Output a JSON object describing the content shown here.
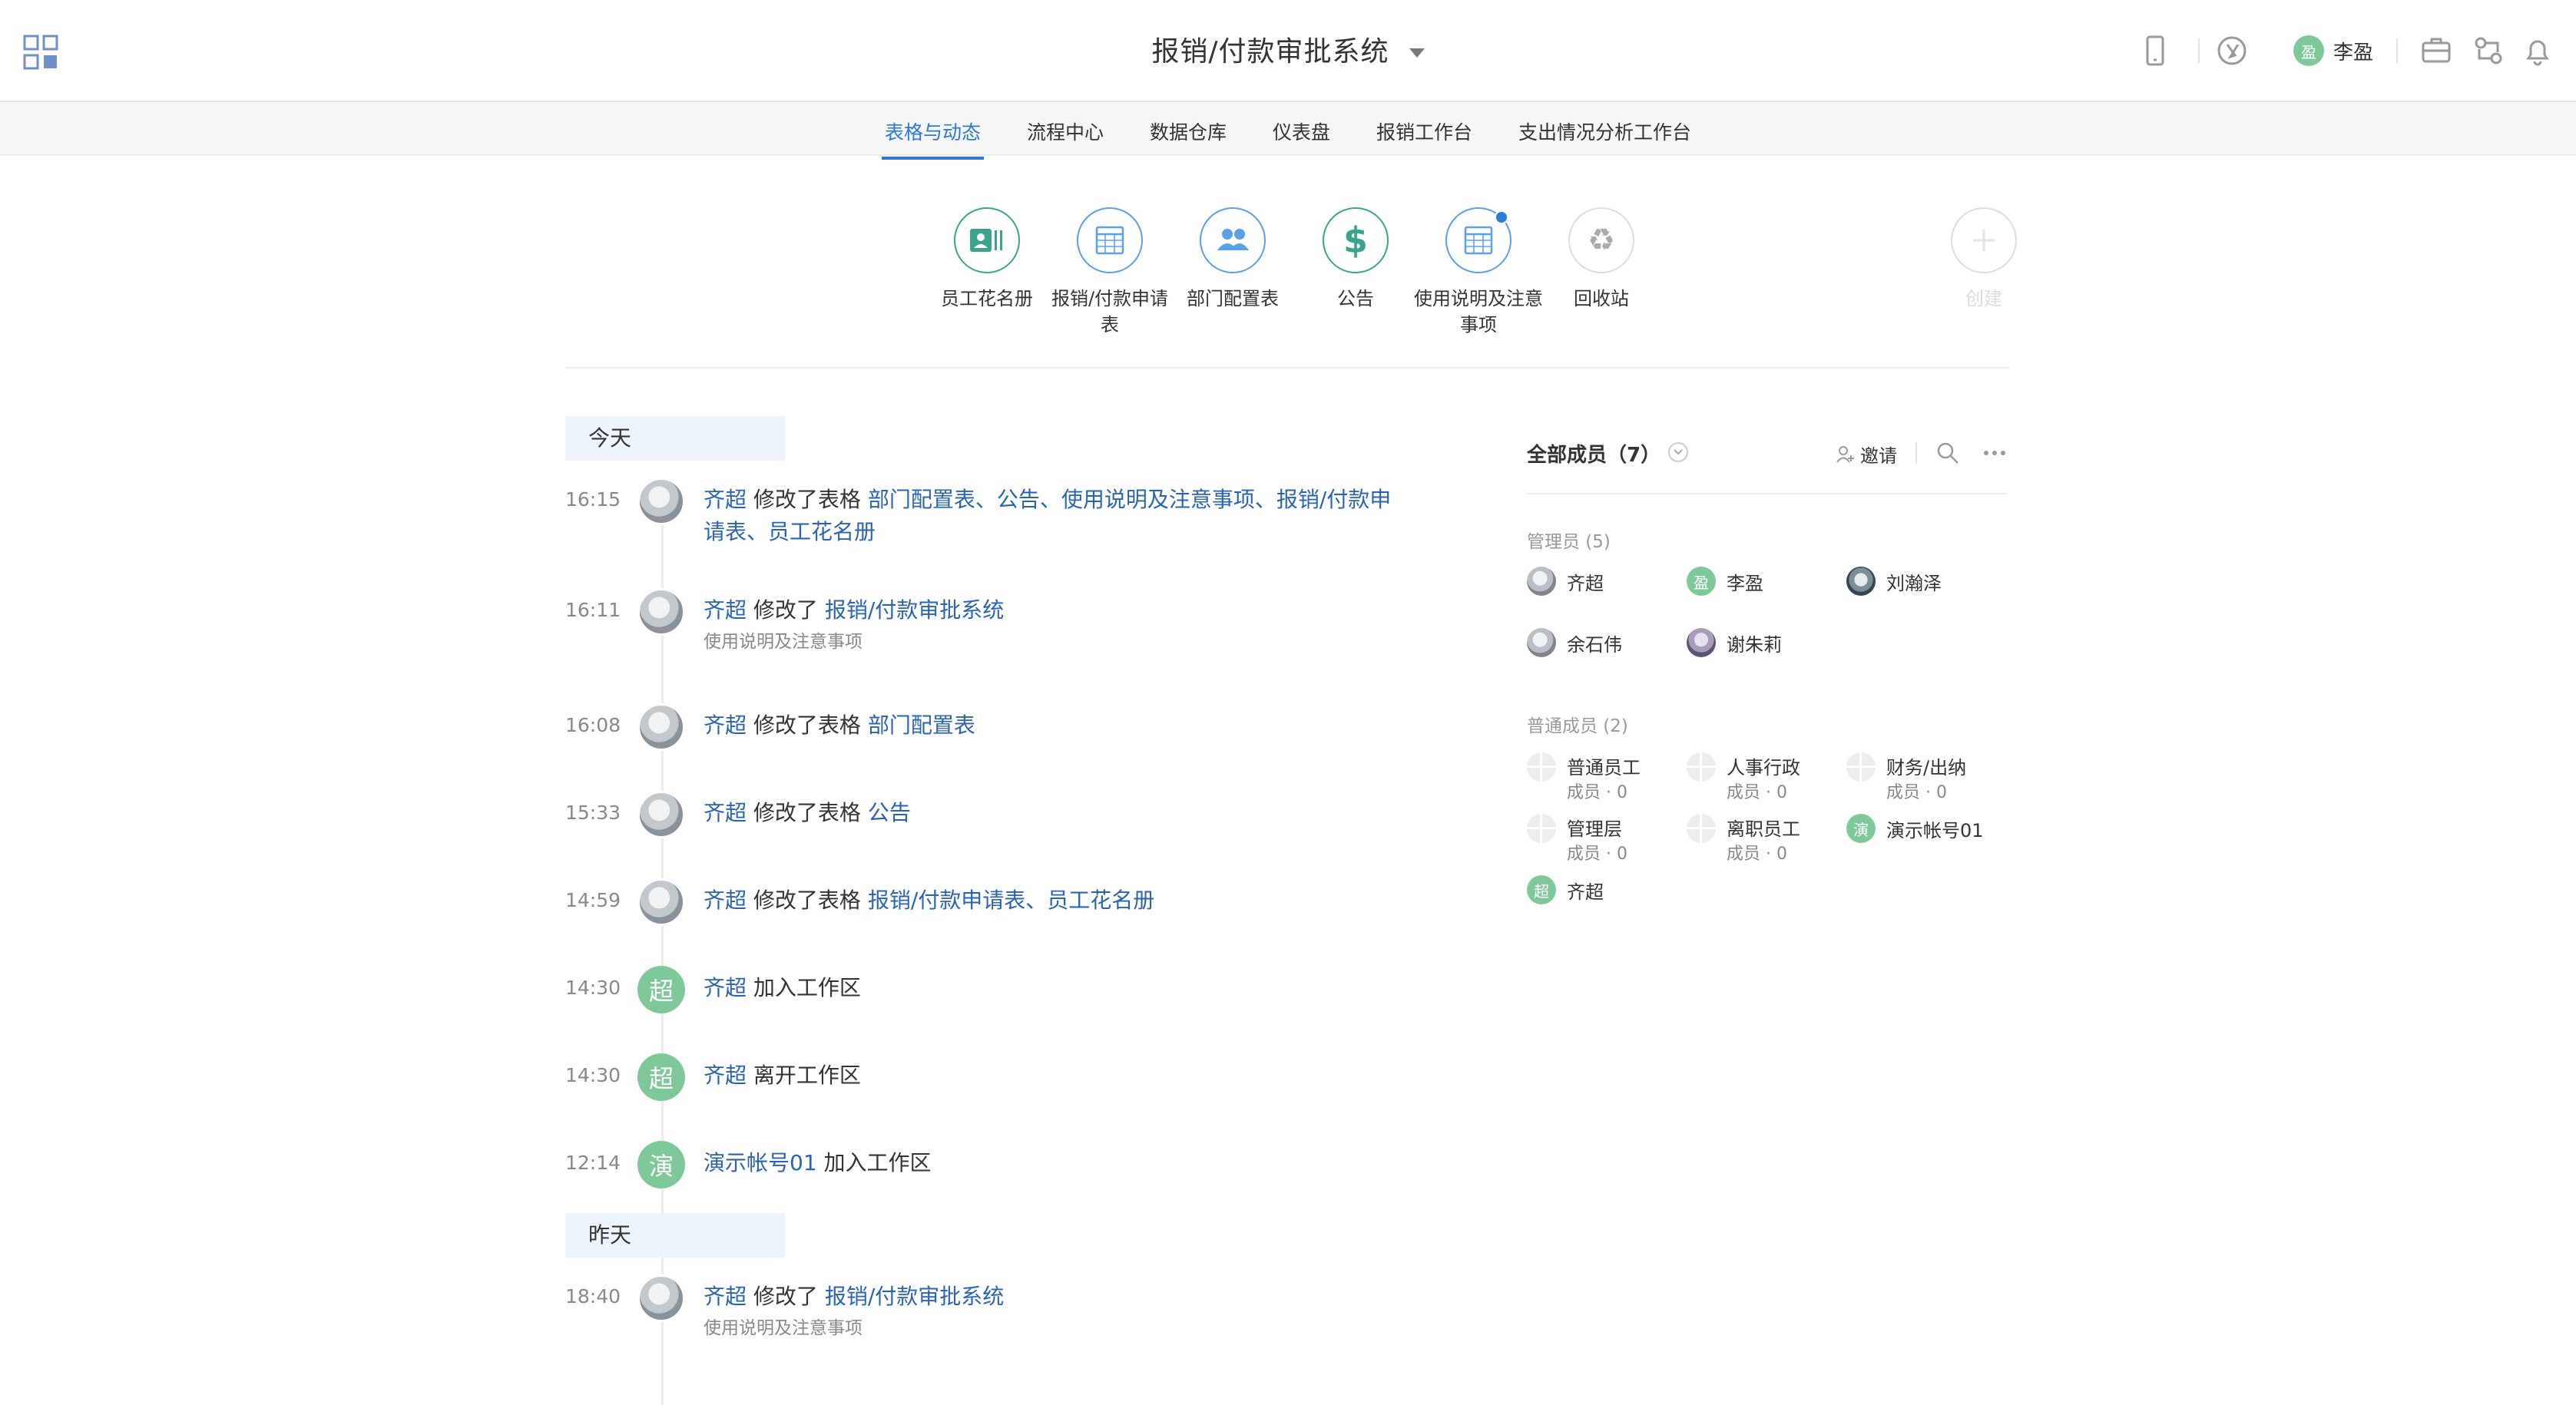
{
  "header": {
    "title": "报销/付款审批系统",
    "user_name": "李盈",
    "user_avatar_char": "盈"
  },
  "tabs": [
    {
      "label": "表格与动态",
      "active": true
    },
    {
      "label": "流程中心"
    },
    {
      "label": "数据仓库"
    },
    {
      "label": "仪表盘"
    },
    {
      "label": "报销工作台"
    },
    {
      "label": "支出情况分析工作台"
    }
  ],
  "sheets": [
    {
      "label": "员工花名册",
      "icon": "contact-card-icon"
    },
    {
      "label": "报销/付款申请表",
      "icon": "table-icon"
    },
    {
      "label": "部门配置表",
      "icon": "people-icon"
    },
    {
      "label": "公告",
      "icon": "dollar-icon"
    },
    {
      "label": "使用说明及注意事项",
      "icon": "table-icon"
    },
    {
      "label": "回收站",
      "icon": "recycle-icon"
    },
    {
      "label": "创建",
      "icon": "plus-icon"
    }
  ],
  "feed": {
    "today_label": "今天",
    "yesterday_label": "昨天",
    "items": [
      {
        "time": "16:15",
        "user": "齐超",
        "action": "修改了表格",
        "targets": "部门配置表、公告、使用说明及注意事项、报销/付款申请表、员工花名册",
        "sub": ""
      },
      {
        "time": "16:11",
        "user": "齐超",
        "action": "修改了",
        "targets": "报销/付款审批系统",
        "sub": "使用说明及注意事项"
      },
      {
        "time": "16:08",
        "user": "齐超",
        "action": "修改了表格",
        "targets": "部门配置表",
        "sub": ""
      },
      {
        "time": "15:33",
        "user": "齐超",
        "action": "修改了表格",
        "targets": "公告",
        "sub": ""
      },
      {
        "time": "14:59",
        "user": "齐超",
        "action": "修改了表格",
        "targets": "报销/付款申请表、员工花名册",
        "sub": ""
      },
      {
        "time": "14:30",
        "user": "齐超",
        "action": "加入工作区",
        "targets": "",
        "sub": "",
        "avatar_char": "超"
      },
      {
        "time": "14:30",
        "user": "齐超",
        "action": "离开工作区",
        "targets": "",
        "sub": "",
        "avatar_char": "超"
      },
      {
        "time": "12:14",
        "user": "演示帐号01",
        "action": "加入工作区",
        "targets": "",
        "sub": "",
        "avatar_char": "演"
      },
      {
        "time": "18:40",
        "user": "齐超",
        "action": "修改了",
        "targets": "报销/付款审批系统",
        "sub": "使用说明及注意事项"
      }
    ]
  },
  "members": {
    "title": "全部成员（7）",
    "invite_label": "邀请",
    "admins_label": "管理员 (5)",
    "admins": [
      {
        "name": "齐超"
      },
      {
        "name": "李盈",
        "avatar_char": "盈"
      },
      {
        "name": "刘瀚泽"
      },
      {
        "name": "余石伟"
      },
      {
        "name": "谢朱莉"
      }
    ],
    "regular_label": "普通成员 (2)",
    "roles": [
      {
        "name": "普通员工",
        "count": "成员 · 0"
      },
      {
        "name": "人事行政",
        "count": "成员 · 0"
      },
      {
        "name": "财务/出纳",
        "count": "成员 · 0"
      },
      {
        "name": "管理层",
        "count": "成员 · 0"
      },
      {
        "name": "离职员工",
        "count": "成员 · 0"
      }
    ],
    "regular": [
      {
        "name": "演示帐号01",
        "avatar_char": "演"
      },
      {
        "name": "齐超",
        "avatar_char": "超"
      }
    ]
  },
  "colors": {
    "accent": "#2a7ad6",
    "link": "#2a64b0",
    "green_avatar": "#7ec89a"
  }
}
